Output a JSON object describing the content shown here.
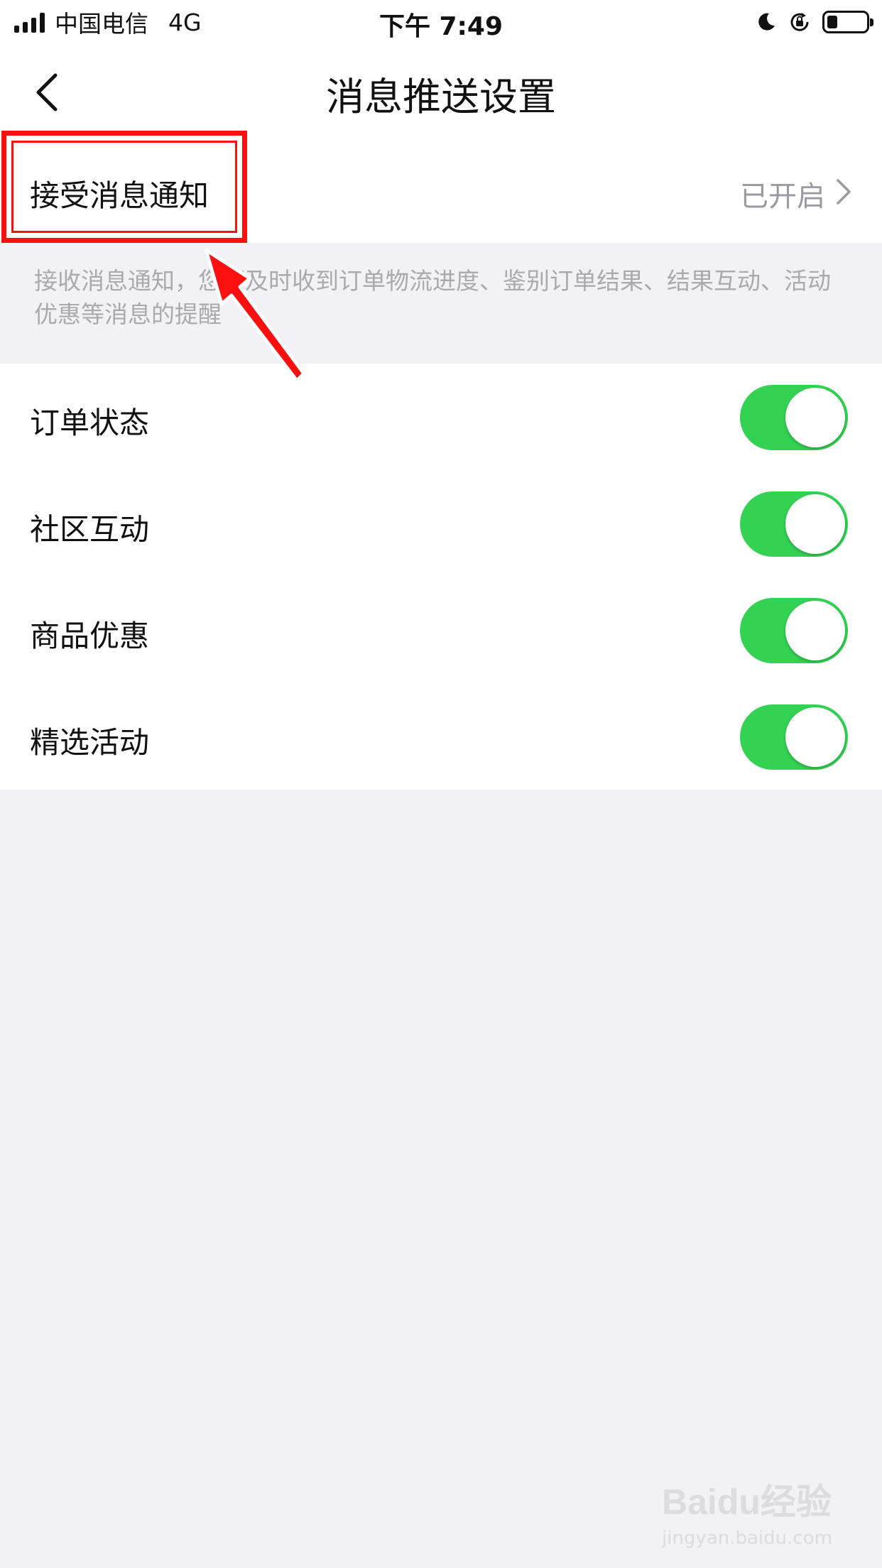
{
  "statusbar": {
    "carrier": "中国电信",
    "network": "4G",
    "time": "下午 7:49"
  },
  "navbar": {
    "title": "消息推送设置",
    "back_icon": "chevron-left-icon"
  },
  "accept_row": {
    "label": "接受消息通知",
    "status": "已开启"
  },
  "description": "接收消息通知，您可及时收到订单物流进度、鉴别订单结果、结果互动、活动优惠等消息的提醒",
  "settings": [
    {
      "label": "订单状态",
      "enabled": true
    },
    {
      "label": "社区互动",
      "enabled": true
    },
    {
      "label": "商品优惠",
      "enabled": true
    },
    {
      "label": "精选活动",
      "enabled": true
    }
  ],
  "colors": {
    "toggle_on": "#33d253",
    "annotation": "#ff1010",
    "background": "#f2f2f6"
  },
  "watermark": {
    "logo": "Baidu经验",
    "url": "jingyan.baidu.com"
  }
}
